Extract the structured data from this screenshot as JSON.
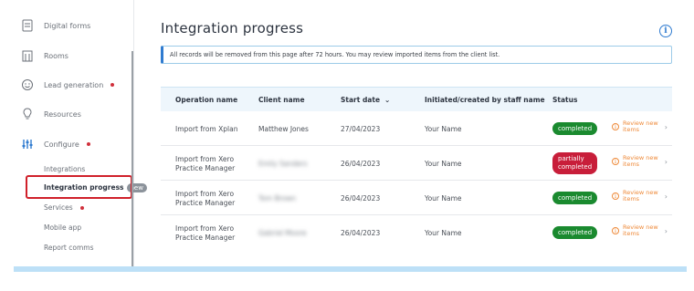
{
  "sidebar": {
    "items": [
      {
        "label": "Digital forms",
        "icon": "document-icon",
        "dot": false
      },
      {
        "label": "Rooms",
        "icon": "building-icon",
        "dot": false
      },
      {
        "label": "Lead generation",
        "icon": "smile-icon",
        "dot": true
      },
      {
        "label": "Resources",
        "icon": "lightbulb-icon",
        "dot": false
      },
      {
        "label": "Configure",
        "icon": "sliders-icon",
        "dot": true
      }
    ],
    "sub_items": [
      {
        "label": "Integrations"
      },
      {
        "label": "Integration progress",
        "badge": "new"
      },
      {
        "label": "Services",
        "dot": true
      },
      {
        "label": "Mobile app"
      },
      {
        "label": "Report comms"
      }
    ]
  },
  "page": {
    "title": "Integration progress",
    "notice": "All records will be removed from this page after 72 hours. You may review imported items from the client list."
  },
  "table": {
    "headers": {
      "operation": "Operation name",
      "client": "Client name",
      "start": "Start date",
      "initiated": "Initiated/created by staff name",
      "status": "Status"
    },
    "rows": [
      {
        "op1": "Import from Xplan",
        "op2": "",
        "client": "Matthew Jones",
        "client_blurred": false,
        "date": "27/04/2023",
        "staff": "Your Name",
        "status1": "completed",
        "status2": "",
        "status_type": "completed",
        "review1": "Review new",
        "review2": "items"
      },
      {
        "op1": "Import from Xero",
        "op2": "Practice Manager",
        "client": "Emily Sanders",
        "client_blurred": true,
        "date": "26/04/2023",
        "staff": "Your Name",
        "status1": "partially",
        "status2": "completed",
        "status_type": "partial",
        "review1": "Review new",
        "review2": "items"
      },
      {
        "op1": "Import from Xero",
        "op2": "Practice Manager",
        "client": "Tom Brown",
        "client_blurred": true,
        "date": "26/04/2023",
        "staff": "Your Name",
        "status1": "completed",
        "status2": "",
        "status_type": "completed",
        "review1": "Review new",
        "review2": "items"
      },
      {
        "op1": "Import from Xero",
        "op2": "Practice Manager",
        "client": "Gabriel Moore",
        "client_blurred": true,
        "date": "26/04/2023",
        "staff": "Your Name",
        "status1": "completed",
        "status2": "",
        "status_type": "completed",
        "review1": "Review new",
        "review2": "items"
      }
    ]
  },
  "colors": {
    "accent": "#2f7bd0",
    "completed": "#1a8a2f",
    "partial": "#c81e3a",
    "review": "#ee8a3a",
    "highlight": "#d0202a"
  }
}
